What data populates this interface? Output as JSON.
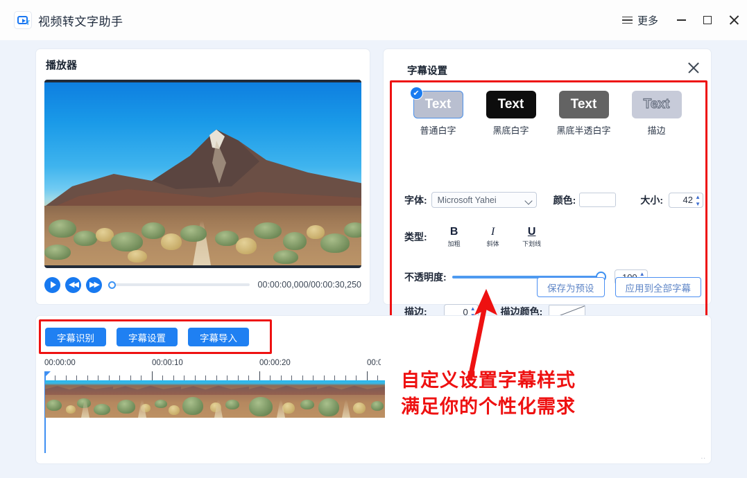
{
  "window": {
    "app_title": "视频转文字助手",
    "logo_mark": "T",
    "more_label": "更多",
    "controls": {
      "menu": "menu-icon",
      "minimize": "minimize-icon",
      "maximize": "maximize-icon",
      "close": "close-icon"
    }
  },
  "player": {
    "title": "播放器",
    "time_display": "00:00:00,000/00:00:30,250",
    "controls": {
      "play": "play-icon",
      "rewind": "rewind-icon",
      "forward": "fast-forward-icon"
    },
    "progress_percent": 0
  },
  "settings": {
    "title": "字幕设置",
    "close": "close-icon",
    "presets": [
      {
        "label": "普通白字",
        "preview_text": "Text",
        "selected": true
      },
      {
        "label": "黑底白字",
        "preview_text": "Text",
        "selected": false
      },
      {
        "label": "黑底半透白字",
        "preview_text": "Text",
        "selected": false
      },
      {
        "label": "描边",
        "preview_text": "Text",
        "selected": false
      }
    ],
    "font": {
      "label": "字体:",
      "value": "Microsoft Yahei"
    },
    "color": {
      "label": "颜色:",
      "value": "#ffffff"
    },
    "size": {
      "label": "大小:",
      "value": "42"
    },
    "type": {
      "label": "类型:",
      "options": [
        {
          "glyph": "B",
          "label": "加粗"
        },
        {
          "glyph": "I",
          "label": "斜体"
        },
        {
          "glyph": "U",
          "label": "下划线"
        }
      ]
    },
    "opacity": {
      "label": "不透明度:",
      "value": "100",
      "percent": 100
    },
    "stroke": {
      "label": "描边:",
      "value": "0"
    },
    "stroke_color": {
      "label": "描边颜色:",
      "value": "none"
    },
    "footer": {
      "save_preset": "保存为预设",
      "apply_all": "应用到全部字幕"
    }
  },
  "timeline": {
    "actions": [
      {
        "label": "字幕识别"
      },
      {
        "label": "字幕设置"
      },
      {
        "label": "字幕导入"
      }
    ],
    "ruler_labels": [
      "00:00:00",
      "00:00:10",
      "00:00:20",
      "00:0("
    ],
    "playhead_position": "00:00:00"
  },
  "annotation": {
    "line1": "自定义设置字幕样式",
    "line2": "满足你的个性化需求",
    "color": "#ee1111"
  },
  "accent": {
    "blue": "#1f80f2",
    "red": "#ee1111"
  }
}
